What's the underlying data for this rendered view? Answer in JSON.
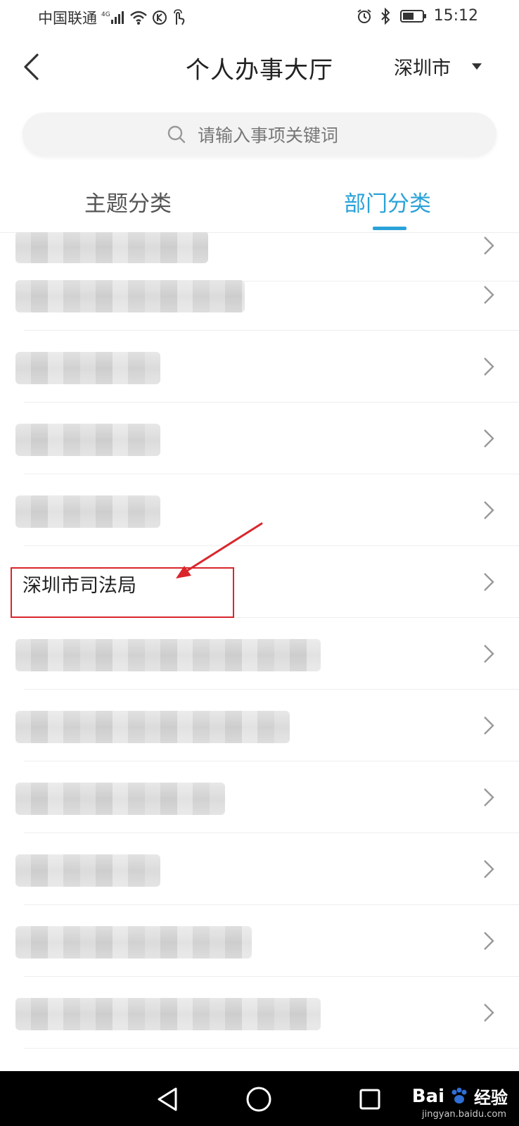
{
  "status_bar": {
    "carrier": "中国联通",
    "network": "4G",
    "time": "15:12"
  },
  "header": {
    "title": "个人办事大厅",
    "city": "深圳市"
  },
  "search": {
    "placeholder": "请输入事项关键词"
  },
  "tabs": [
    {
      "label": "主题分类",
      "active": false
    },
    {
      "label": "部门分类",
      "active": true
    }
  ],
  "department_list": [
    {
      "label": "",
      "redacted": true
    },
    {
      "label": "",
      "redacted": true
    },
    {
      "label": "",
      "redacted": true
    },
    {
      "label": "",
      "redacted": true
    },
    {
      "label": "",
      "redacted": true
    },
    {
      "label": "深圳市司法局",
      "redacted": false,
      "highlighted": true
    },
    {
      "label": "",
      "redacted": true
    },
    {
      "label": "",
      "redacted": true
    },
    {
      "label": "",
      "redacted": true
    },
    {
      "label": "",
      "redacted": true
    },
    {
      "label": "",
      "redacted": true
    },
    {
      "label": "",
      "redacted": true
    }
  ],
  "watermark": {
    "brand": "Bai",
    "suffix": "经验",
    "url": "jingyan.baidu.com"
  },
  "colors": {
    "accent": "#2aa2d8",
    "highlight": "#d9262c",
    "nav_bar": "#000000"
  }
}
